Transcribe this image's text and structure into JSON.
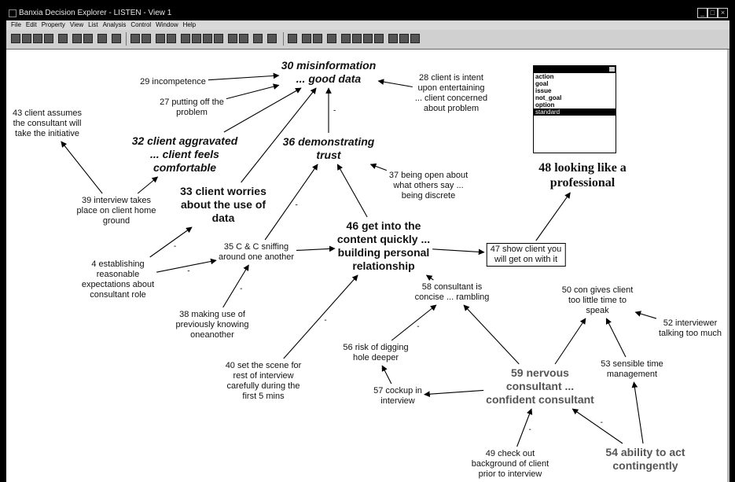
{
  "window": {
    "title": "Banxia Decision Explorer - LISTEN - View 1"
  },
  "menu": [
    "File",
    "Edit",
    "Property",
    "View",
    "List",
    "Analysis",
    "Control",
    "Window",
    "Help"
  ],
  "legend": {
    "items": [
      "action",
      "goal",
      "issue",
      "not_goal",
      "option",
      "standard"
    ],
    "selected": "standard"
  },
  "nodes": {
    "n29": "29 incompetence",
    "n30": "30 misinformation\n... good data",
    "n28": "28 client is intent\nupon entertaining\n... client concerned\nabout problem",
    "n27": "27 putting off the\nproblem",
    "n43": "43 client assumes\nthe consultant will\ntake the initiative",
    "n32": "32 client aggravated\n... client feels\ncomfortable",
    "n36": "36 demonstrating\ntrust",
    "n37": "37 being open about\nwhat others say ...\nbeing discrete",
    "n48": "48 looking like a\nprofessional",
    "n39": "39 interview takes\nplace on client home\nground",
    "n33": "33 client worries\nabout the use of\ndata",
    "n46": "46 get into the\ncontent quickly ...\nbuilding personal\nrelationship",
    "n35": "35 C & C sniffing\naround one another",
    "n4": "4 establishing\nreasonable\nexpectations about\nconsultant role",
    "n47": "47 show client you\nwill get on with it",
    "n58": "58 consultant is\nconcise ... rambling",
    "n50": "50 con gives client\ntoo little time to\nspeak",
    "n52": "52 interviewer\ntalking too much",
    "n38": "38 making use of\npreviously knowing\noneanother",
    "n56": "56 risk of digging\nhole deeper",
    "n53": "53 sensible time\nmanagement",
    "n40": "40 set the scene for\nrest of interview\ncarefully during the\nfirst 5 mins",
    "n59": "59 nervous\nconsultant ...\nconfident consultant",
    "n57": "57 cockup in\ninterview",
    "n54": "54 ability to act\ncontingently",
    "n49": "49 check out\nbackground of client\nprior to interview"
  },
  "links": [
    {
      "from": "n29",
      "to": "n30",
      "neg": false
    },
    {
      "from": "n27",
      "to": "n30",
      "neg": false
    },
    {
      "from": "n28",
      "to": "n30",
      "neg": false
    },
    {
      "from": "n32",
      "to": "n30",
      "neg": false
    },
    {
      "from": "n33",
      "to": "n30",
      "neg": false
    },
    {
      "from": "n36",
      "to": "n30",
      "neg": true
    },
    {
      "from": "n39",
      "to": "n43",
      "neg": false
    },
    {
      "from": "n39",
      "to": "n32",
      "neg": false
    },
    {
      "from": "n4",
      "to": "n33",
      "neg": true
    },
    {
      "from": "n4",
      "to": "n35",
      "neg": true
    },
    {
      "from": "n35",
      "to": "n36",
      "neg": true
    },
    {
      "from": "n46",
      "to": "n36",
      "neg": false
    },
    {
      "from": "n37",
      "to": "n36",
      "neg": false
    },
    {
      "from": "n35",
      "to": "n46",
      "neg": false
    },
    {
      "from": "n38",
      "to": "n35",
      "neg": true
    },
    {
      "from": "n40",
      "to": "n46",
      "neg": true
    },
    {
      "from": "n46",
      "to": "n47",
      "neg": false
    },
    {
      "from": "n47",
      "to": "n48",
      "neg": false
    },
    {
      "from": "n58",
      "to": "n46",
      "neg": false
    },
    {
      "from": "n56",
      "to": "n58",
      "neg": true
    },
    {
      "from": "n57",
      "to": "n56",
      "neg": false
    },
    {
      "from": "n59",
      "to": "n57",
      "neg": false
    },
    {
      "from": "n59",
      "to": "n58",
      "neg": false
    },
    {
      "from": "n59",
      "to": "n50",
      "neg": false
    },
    {
      "from": "n53",
      "to": "n50",
      "neg": false
    },
    {
      "from": "n52",
      "to": "n50",
      "neg": false
    },
    {
      "from": "n54",
      "to": "n53",
      "neg": false
    },
    {
      "from": "n54",
      "to": "n59",
      "neg": true
    },
    {
      "from": "n49",
      "to": "n59",
      "neg": true
    }
  ]
}
